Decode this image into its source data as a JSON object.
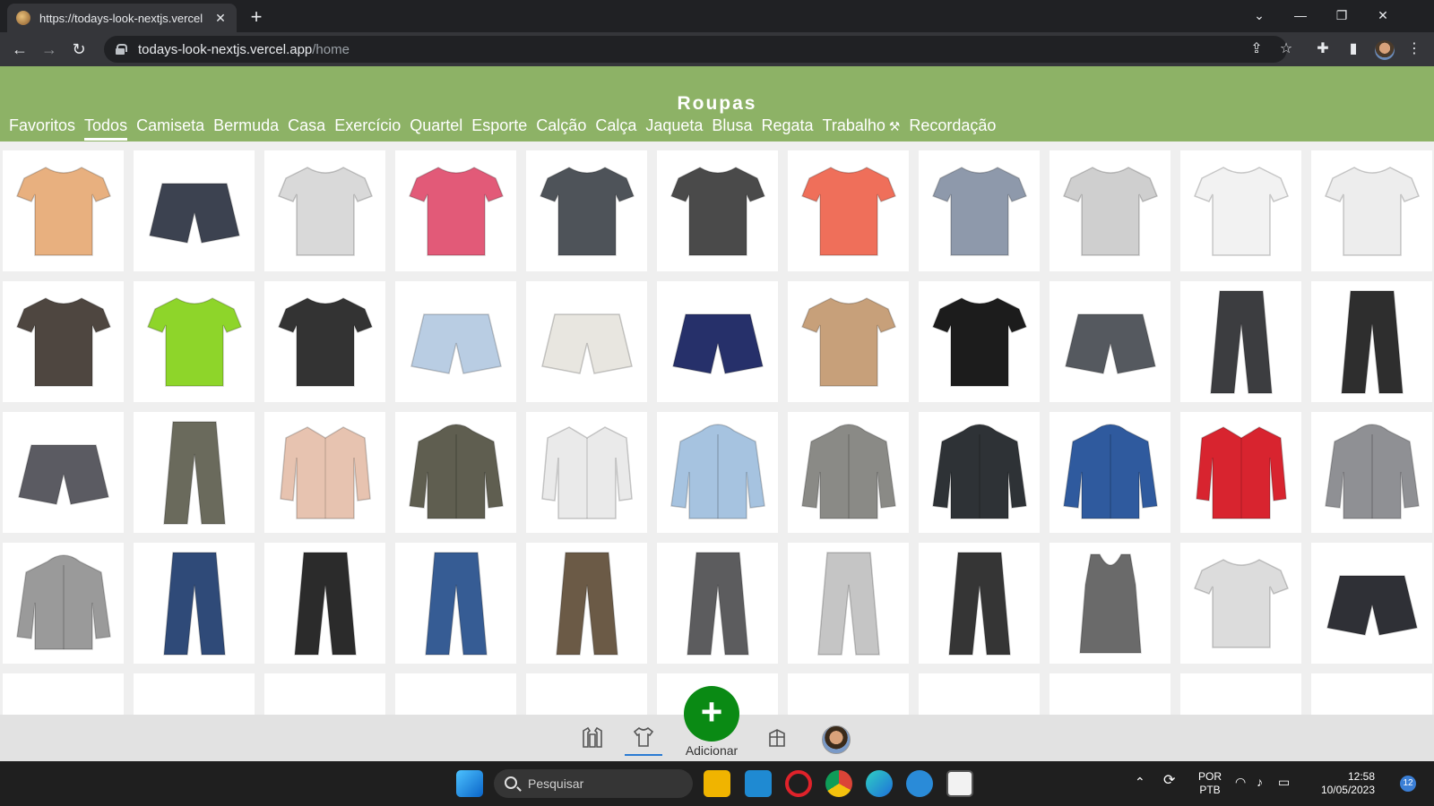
{
  "browser": {
    "tab_title": "https://todays-look-nextjs.vercel",
    "url_host": "todays-look-nextjs.vercel.app",
    "url_path": "/home"
  },
  "app": {
    "title": "Roupas",
    "categories": [
      "Favoritos",
      "Todos",
      "Camiseta",
      "Bermuda",
      "Casa",
      "Exercício",
      "Quartel",
      "Esporte",
      "Calção",
      "Calça",
      "Jaqueta",
      "Blusa",
      "Regata",
      "Trabalho",
      "Recordação"
    ],
    "active_category": "Todos",
    "trabalho_icon": "hammer-pick-icon"
  },
  "grid": {
    "items": [
      {
        "kind": "tshirt",
        "color": "#e8b07f"
      },
      {
        "kind": "shorts",
        "color": "#3c4250"
      },
      {
        "kind": "tshirt",
        "color": "#d9d9d9"
      },
      {
        "kind": "tshirt",
        "color": "#e25a78"
      },
      {
        "kind": "tshirt",
        "color": "#4e5359"
      },
      {
        "kind": "tshirt",
        "color": "#4a4a4a"
      },
      {
        "kind": "tshirt",
        "color": "#ef6f5a"
      },
      {
        "kind": "tshirt",
        "color": "#8e99ab"
      },
      {
        "kind": "tshirt",
        "color": "#cfcfcf"
      },
      {
        "kind": "tshirt",
        "color": "#f2f2f2"
      },
      {
        "kind": "tshirt",
        "color": "#ededed"
      },
      {
        "kind": "tshirt",
        "color": "#4e4640"
      },
      {
        "kind": "tshirt",
        "color": "#8ed52a"
      },
      {
        "kind": "tshirt",
        "color": "#333333"
      },
      {
        "kind": "shorts",
        "color": "#b9cde3"
      },
      {
        "kind": "shorts",
        "color": "#e8e6e0"
      },
      {
        "kind": "shorts",
        "color": "#26306a"
      },
      {
        "kind": "tshirt",
        "color": "#c7a07a"
      },
      {
        "kind": "tshirt",
        "color": "#1c1c1c"
      },
      {
        "kind": "shorts",
        "color": "#55595f"
      },
      {
        "kind": "pants",
        "color": "#3c3d40"
      },
      {
        "kind": "pants",
        "color": "#2e2e2e"
      },
      {
        "kind": "shorts",
        "color": "#5b5b62"
      },
      {
        "kind": "pants",
        "color": "#6a6a5c"
      },
      {
        "kind": "shirt",
        "color": "#e7c3b0"
      },
      {
        "kind": "jacket",
        "color": "#5f5e50"
      },
      {
        "kind": "shirt",
        "color": "#eaeaea"
      },
      {
        "kind": "jacket",
        "color": "#a6c3e0"
      },
      {
        "kind": "jacket",
        "color": "#8a8a86"
      },
      {
        "kind": "jacket",
        "color": "#2e3236"
      },
      {
        "kind": "jacket",
        "color": "#2f5a9e"
      },
      {
        "kind": "shirt",
        "color": "#d8242f"
      },
      {
        "kind": "jacket",
        "color": "#8f9094"
      },
      {
        "kind": "jacket",
        "color": "#9a9a9a"
      },
      {
        "kind": "pants",
        "color": "#2f4a78"
      },
      {
        "kind": "pants",
        "color": "#2b2b2b"
      },
      {
        "kind": "pants",
        "color": "#365c94"
      },
      {
        "kind": "pants",
        "color": "#6b5a46"
      },
      {
        "kind": "pants",
        "color": "#5c5c5e"
      },
      {
        "kind": "pants",
        "color": "#c5c5c5"
      },
      {
        "kind": "pants",
        "color": "#353535"
      },
      {
        "kind": "tank",
        "color": "#6a6a6a"
      },
      {
        "kind": "tshirt",
        "color": "#dcdcdc"
      },
      {
        "kind": "shorts",
        "color": "#2f3036"
      },
      {
        "kind": "partial",
        "color": "#6f6f65"
      },
      {
        "kind": "partial",
        "color": "#4a4d30"
      },
      {
        "kind": "partial",
        "color": "#6ab0a8"
      },
      {
        "kind": "partial",
        "color": "#cfcfcf"
      },
      {
        "kind": "partial",
        "color": "#c52a3a"
      },
      {
        "kind": "partial",
        "color": "#9a9a9a"
      },
      {
        "kind": "partial",
        "color": "#3a3a3a"
      },
      {
        "kind": "partial",
        "color": "#4a6fa8"
      },
      {
        "kind": "partial",
        "color": "#5a78a8"
      },
      {
        "kind": "partial",
        "color": "#3a3a3a"
      },
      {
        "kind": "partial",
        "color": "#4a6fa0"
      }
    ]
  },
  "bottom_nav": {
    "add_label": "Adicionar"
  },
  "taskbar": {
    "search_placeholder": "Pesquisar",
    "lang_line1": "POR",
    "lang_line2": "PTB",
    "time": "12:58",
    "date": "10/05/2023",
    "notifications": "12"
  },
  "colors": {
    "header_green": "#8db266",
    "add_button_green": "#0a8a14"
  }
}
